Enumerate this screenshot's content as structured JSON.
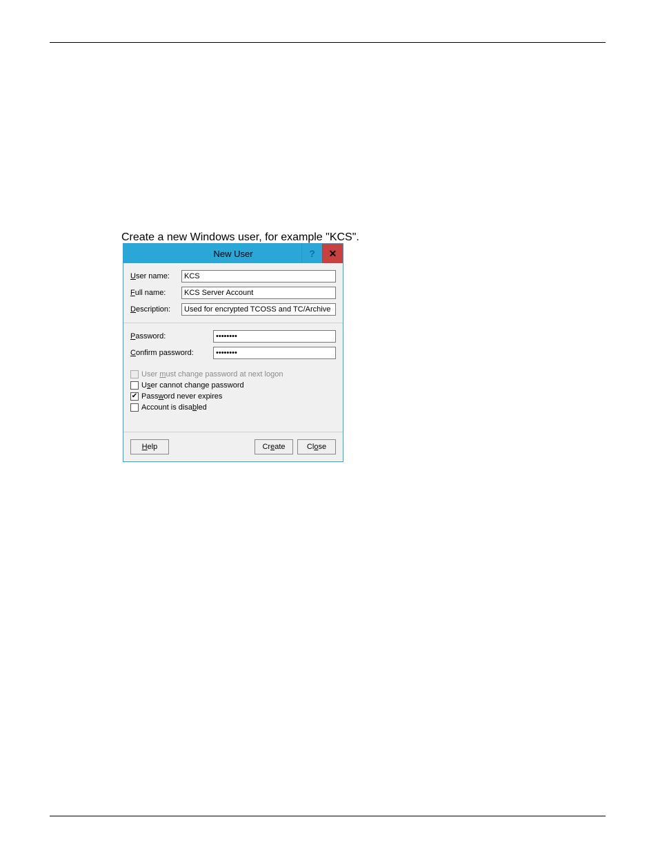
{
  "caption": "Create a new Windows user, for example \"KCS\".",
  "dialog": {
    "title": "New User",
    "fields": {
      "username_label_pre": "",
      "username_label_u": "U",
      "username_label_post": "ser name:",
      "username_value": "KCS",
      "fullname_label_pre": "",
      "fullname_label_u": "F",
      "fullname_label_post": "ull name:",
      "fullname_value": "KCS Server Account",
      "description_label_pre": "",
      "description_label_u": "D",
      "description_label_post": "escription:",
      "description_value": "Used for encrypted TCOSS and TC/Archive data",
      "password_label_pre": "",
      "password_label_u": "P",
      "password_label_post": "assword:",
      "password_value": "••••••••",
      "confirm_label_pre": "",
      "confirm_label_u": "C",
      "confirm_label_post": "onfirm password:",
      "confirm_value": "••••••••"
    },
    "checkboxes": {
      "must_change_pre": "User ",
      "must_change_u": "m",
      "must_change_post": "ust change password at next logon",
      "must_change_checked": false,
      "must_change_disabled": true,
      "cannot_change_pre": "U",
      "cannot_change_u": "s",
      "cannot_change_post": "er cannot change password",
      "cannot_change_checked": false,
      "never_expires_pre": "Pass",
      "never_expires_u": "w",
      "never_expires_post": "ord never expires",
      "never_expires_checked": true,
      "never_expires_mark": "✔",
      "disabled_pre": "Account is disa",
      "disabled_u": "b",
      "disabled_post": "led",
      "disabled_checked": false
    },
    "buttons": {
      "help_pre": "",
      "help_u": "H",
      "help_post": "elp",
      "create_pre": "Cr",
      "create_u": "e",
      "create_post": "ate",
      "close_pre": "Cl",
      "close_u": "o",
      "close_post": "se"
    }
  }
}
